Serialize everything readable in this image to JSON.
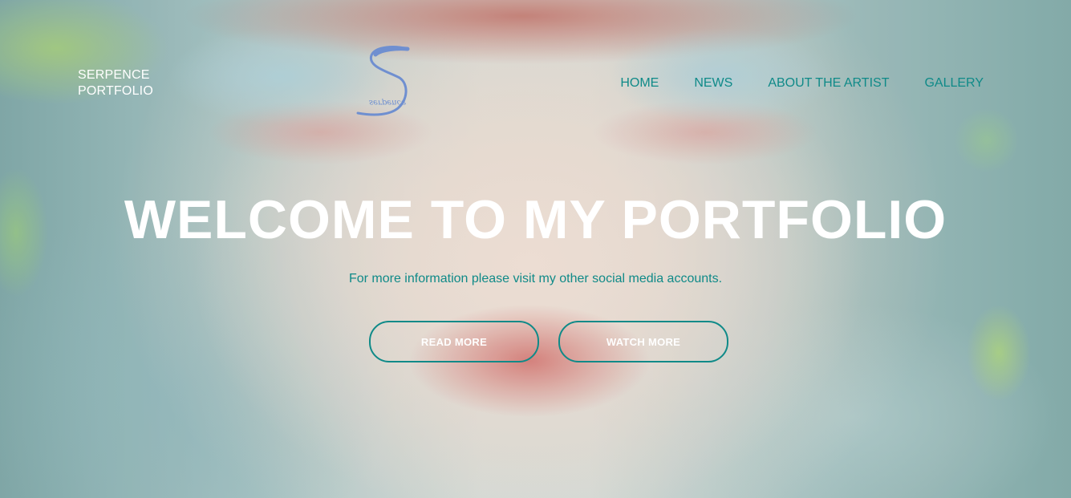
{
  "brand": {
    "line1": "SERPENCE",
    "line2": "PORTFOLIO"
  },
  "logo": {
    "icon": "serpence-s-logo",
    "signature": "serpence",
    "color": "#6f8fd0"
  },
  "nav": {
    "items": [
      {
        "label": "HOME"
      },
      {
        "label": "NEWS"
      },
      {
        "label": "ABOUT THE ARTIST"
      },
      {
        "label": "GALLERY"
      }
    ]
  },
  "hero": {
    "title": "WELCOME TO MY PORTFOLIO",
    "subtitle": "For more information please visit my other social media accounts.",
    "buttons": [
      {
        "label": "READ MORE"
      },
      {
        "label": "WATCH MORE"
      }
    ]
  },
  "colors": {
    "accent": "#0f8a88",
    "text_light": "#ffffff"
  }
}
